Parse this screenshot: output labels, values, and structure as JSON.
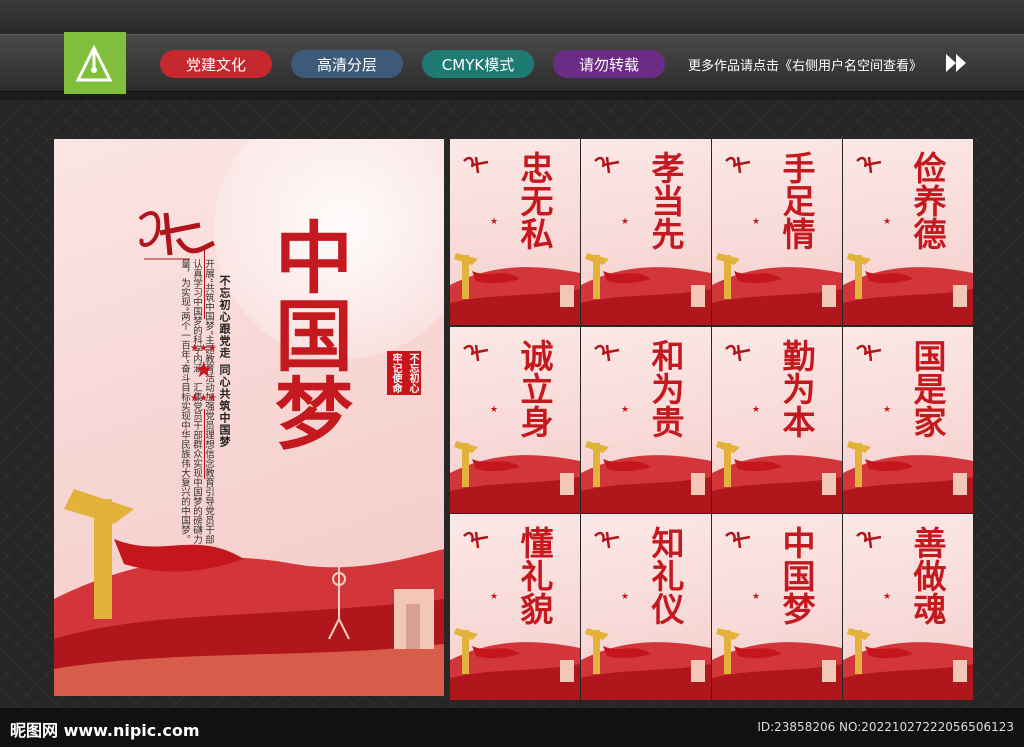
{
  "header": {
    "tags": [
      {
        "label": "党建文化",
        "color": "#c5292f"
      },
      {
        "label": "高清分层",
        "color": "#3d5b79"
      },
      {
        "label": "CMYK模式",
        "color": "#1f7a74"
      },
      {
        "label": "请勿转载",
        "color": "#6a2c84"
      }
    ],
    "promo": "更多作品请点击《右侧用户名空间查看》"
  },
  "main_poster": {
    "title": "中国梦",
    "slogan": "不忘初心跟党走  同心共筑中国梦",
    "body": "开展“共筑中国梦”主题教育活动加强党员理想信念教育引导党员干部认真学习中国梦的科学内涵，汇集党员干部群众实现中国梦的磅礴力量，为实现“两个一百年”奋斗目标实现中华民族伟大复兴的中国梦。",
    "seal_1": "不忘初心",
    "seal_2": "牢记使命"
  },
  "cards": [
    {
      "title": "忠无私"
    },
    {
      "title": "孝当先"
    },
    {
      "title": "手足情"
    },
    {
      "title": "俭养德"
    },
    {
      "title": "诚立身"
    },
    {
      "title": "和为贵"
    },
    {
      "title": "勤为本"
    },
    {
      "title": "国是家"
    },
    {
      "title": "懂礼貌"
    },
    {
      "title": "知礼仪"
    },
    {
      "title": "中国梦"
    },
    {
      "title": "善做魂"
    }
  ],
  "footer": {
    "site": "昵图网 www.nipic.com",
    "id_text": "ID:23858206 NO:20221027222056506123"
  },
  "colors": {
    "accent_red": "#c41a1f",
    "logo_green": "#7fbf3c",
    "gold": "#e2b23a"
  }
}
